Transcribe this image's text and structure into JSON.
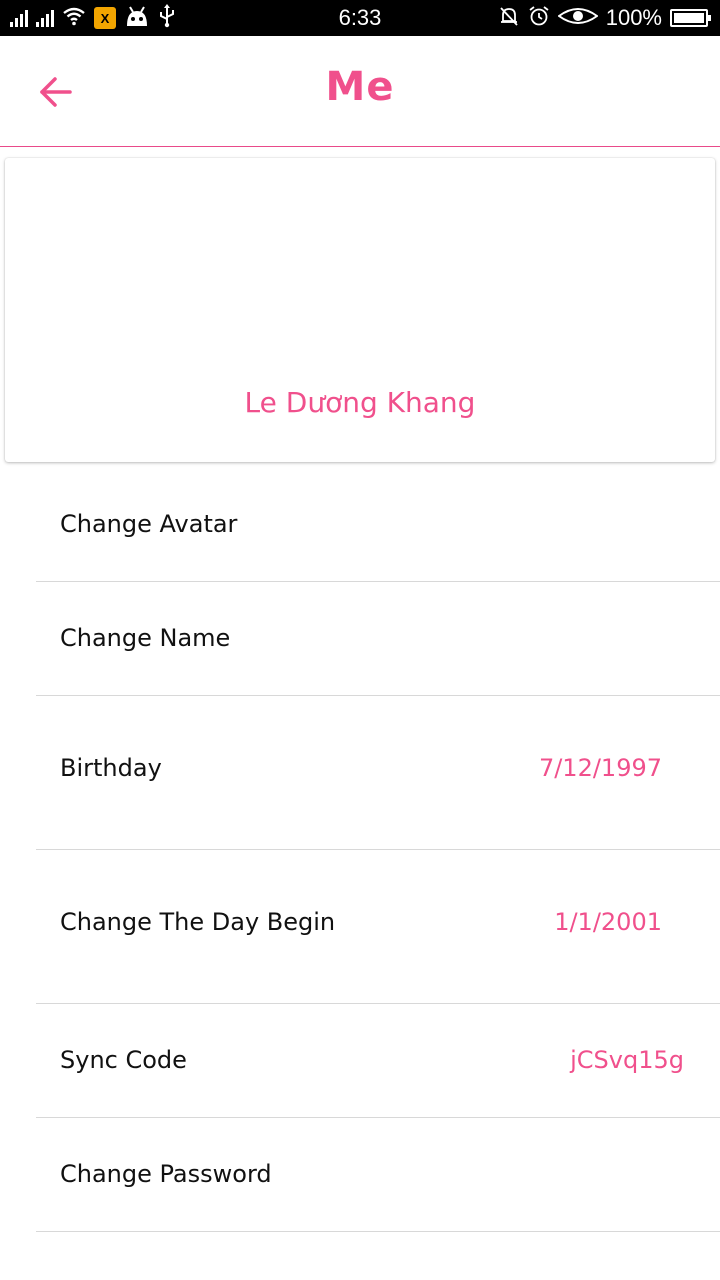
{
  "status_bar": {
    "time": "6:33",
    "battery_percent": "100%",
    "battery_level": 1.0,
    "left_icons": [
      "signal-icon",
      "signal-icon",
      "wifi-icon",
      "xi-app-icon",
      "android-icon",
      "usb-icon"
    ],
    "right_icons": [
      "bell-off-icon",
      "alarm-icon",
      "eye-icon",
      "battery-icon"
    ]
  },
  "app_bar": {
    "title": "Me",
    "back_icon": "arrow-left-icon"
  },
  "profile": {
    "name": "Le Dương Khang"
  },
  "settings": {
    "change_avatar": {
      "label": "Change Avatar"
    },
    "change_name": {
      "label": "Change Name"
    },
    "birthday": {
      "label": "Birthday",
      "value": "7/12/1997"
    },
    "day_begin": {
      "label": "Change The Day Begin",
      "value": "1/1/2001"
    },
    "sync_code": {
      "label": "Sync Code",
      "value": "jCSvq15g"
    },
    "change_password": {
      "label": "Change Password"
    }
  },
  "colors": {
    "accent": "#f0508c",
    "statusbar": "#000000",
    "divider": "#d8d8d8"
  }
}
